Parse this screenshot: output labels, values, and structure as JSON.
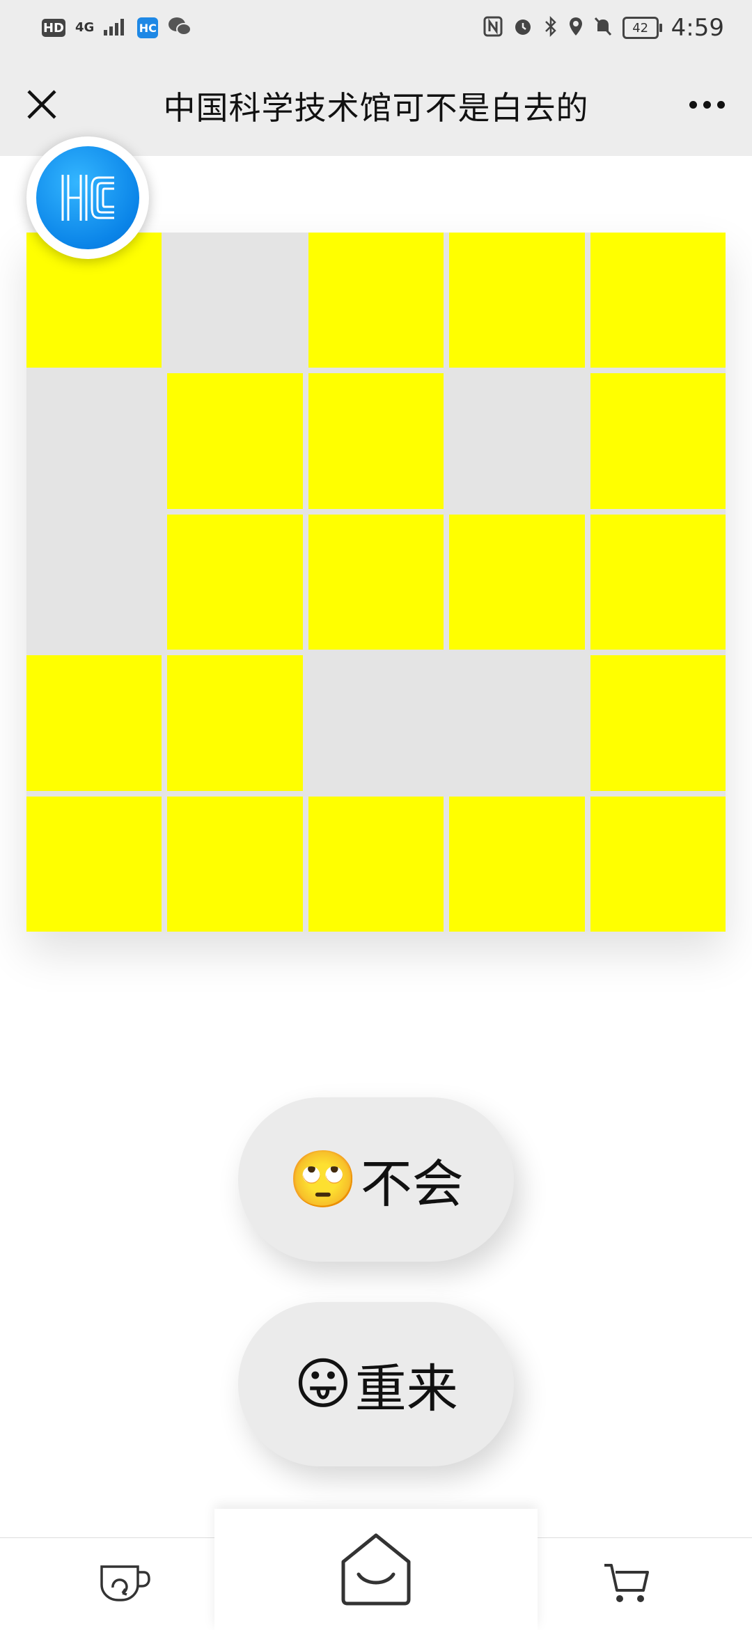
{
  "status_bar": {
    "hd": "HD",
    "network": "4G",
    "app_badge": "HC",
    "battery": "42",
    "time": "4:59"
  },
  "header": {
    "title": "中国科学技术馆可不是白去的"
  },
  "grid": {
    "rows": 5,
    "cols": 5,
    "cells": [
      [
        1,
        0,
        1,
        1,
        1
      ],
      [
        0,
        1,
        1,
        0,
        1
      ],
      [
        0,
        1,
        1,
        1,
        1
      ],
      [
        1,
        1,
        0,
        0,
        1
      ],
      [
        1,
        1,
        1,
        1,
        1
      ]
    ],
    "on_color": "#ffff00",
    "off_color": "#e4e4e4"
  },
  "buttons": {
    "help": {
      "emoji": "🙄",
      "label": "不会"
    },
    "restart": {
      "emoji": "😛",
      "label": "重来"
    }
  },
  "icons": {
    "close": "close-icon",
    "more": "more-icon",
    "logo": "hc-logo-icon",
    "left_nav": "cup-refresh-icon",
    "center_nav": "home-icon",
    "right_nav": "cart-icon"
  },
  "colors": {
    "header_bg": "#ededed",
    "logo_blue": "#0a84e8",
    "cell_on": "#ffff00"
  }
}
